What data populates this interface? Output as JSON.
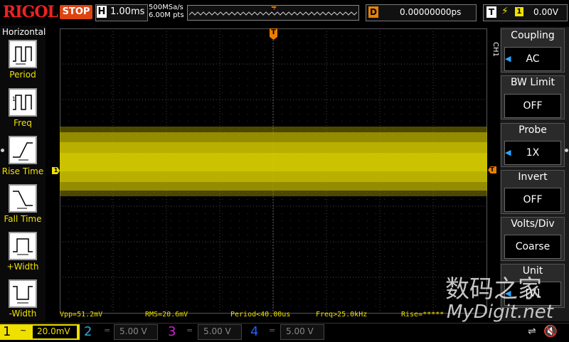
{
  "header": {
    "logo": "RIGOL",
    "run_status": "STOP",
    "timebase_letter": "H",
    "timebase": "1.00ms",
    "sample_rate": "500MSa/s",
    "memory_depth": "6.00M pts",
    "delay_letter": "D",
    "delay": "0.00000000ps",
    "trigger_letter": "T",
    "trigger_source": "1",
    "trigger_level": "0.00V"
  },
  "left_menu": {
    "title": "Horizontal",
    "items": [
      {
        "label": "Period"
      },
      {
        "label": "Freq"
      },
      {
        "label": "Rise Time"
      },
      {
        "label": "Fall Time"
      },
      {
        "label": "+Width"
      },
      {
        "label": "-Width"
      }
    ]
  },
  "markers": {
    "ch1": "1",
    "trigger_pos": "T",
    "trigger_level": "T"
  },
  "measurements": [
    {
      "text": "Vpp=51.2mV"
    },
    {
      "text": "RMS=20.6mV"
    },
    {
      "text": "Period<40.00us"
    },
    {
      "text": "Freq>25.0kHz"
    },
    {
      "text": "Rise=*****"
    }
  ],
  "right_menu": {
    "channel_tab": "CH1",
    "items": [
      {
        "title": "Coupling",
        "value": "AC",
        "has_arrow": true
      },
      {
        "title": "BW Limit",
        "value": "OFF",
        "has_arrow": false
      },
      {
        "title": "Probe",
        "value": "1X",
        "has_arrow": true
      },
      {
        "title": "Invert",
        "value": "OFF",
        "has_arrow": false
      },
      {
        "title": "Volts/Div",
        "value": "Coarse",
        "has_arrow": false
      },
      {
        "title": "Unit",
        "value": "[V]",
        "has_arrow": true
      }
    ]
  },
  "watermark": {
    "cn": "数码之家",
    "en": "MyDigit.net"
  },
  "channels": [
    {
      "num": "1",
      "coupling": "~",
      "scale": "20.0mV",
      "color": "#f0e000",
      "active": true
    },
    {
      "num": "2",
      "coupling": "=",
      "scale": "5.00 V",
      "color": "#2aa4e0",
      "active": false
    },
    {
      "num": "3",
      "coupling": "=",
      "scale": "5.00 V",
      "color": "#d020d0",
      "active": false
    },
    {
      "num": "4",
      "coupling": "=",
      "scale": "5.00 V",
      "color": "#2060ff",
      "active": false
    }
  ],
  "colors": {
    "ch1_trace": "#f0e000",
    "trigger": "#ea8000",
    "menu_arrow": "#29a8ff"
  },
  "icons": {
    "usb": "usb-icon",
    "speaker": "speaker-muted-icon"
  }
}
